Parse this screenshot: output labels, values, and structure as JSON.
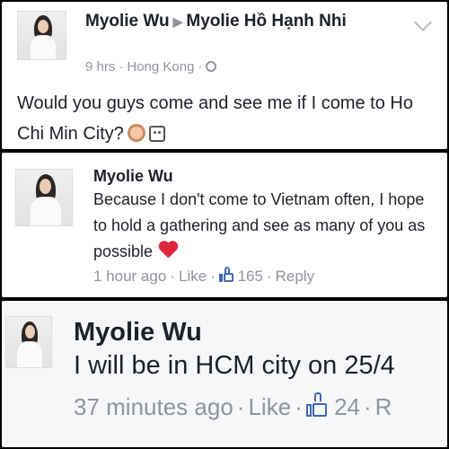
{
  "post": {
    "author": "Myolie Wu",
    "target": "Myolie Hồ Hạnh Nhi",
    "time": "9 hrs",
    "location": "Hong Kong",
    "body": "Would you guys come and see me if I come to Ho Chi Min City?",
    "emoji_1": "girl-emoji",
    "emoji_2": "ghost-emoji"
  },
  "comment1": {
    "author": "Myolie Wu",
    "body": "Because I don't come to Vietnam often, I hope to hold a gathering and see as many of you as possible",
    "emoji": "heart-emoji",
    "time": "1 hour ago",
    "like_label": "Like",
    "like_count": "165",
    "reply_label": "Reply"
  },
  "comment2": {
    "author": "Myolie Wu",
    "body": "I will be in HCM city on 25/4",
    "time": "37 minutes ago",
    "like_label": "Like",
    "like_count": "24",
    "reply_label": "R"
  },
  "colors": {
    "link_blue": "#4267b2",
    "meta_gray": "#90949c",
    "text": "#1d2129",
    "heart_red": "#e0263c"
  }
}
